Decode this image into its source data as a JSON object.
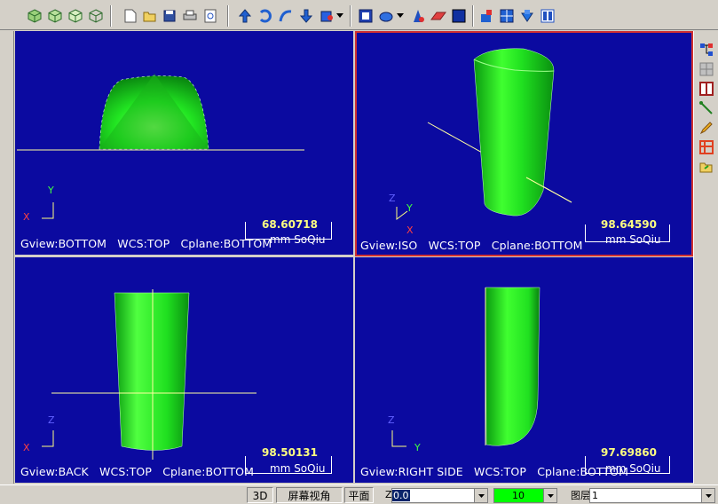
{
  "toolbar": {
    "icons": [
      "cube-iso-icon",
      "cube-top-icon",
      "cube-front-icon",
      "cube-wire-icon",
      "new-file-icon",
      "open-folder-icon",
      "save-icon",
      "print-icon",
      "print-preview-icon",
      "arrow-up-icon",
      "rotate-icon",
      "arc-icon",
      "arrow-down-icon",
      "solid-cube-icon",
      "dropdown-arrow-icon",
      "view-box-icon",
      "shade-icon",
      "dropdown-arrow-icon",
      "edge-icon",
      "eraser-icon",
      "solid-block-icon",
      "layers-icon",
      "grid-icon",
      "import-icon",
      "panel-icon"
    ]
  },
  "viewports": [
    {
      "label": "Gview:BOTTOM   WCS:TOP   Cplane:BOTTOM",
      "scale": "68.60718",
      "unit": "mm  SoQiu",
      "axis1": "X",
      "axis2": "Y"
    },
    {
      "label": "Gview:ISO   WCS:TOP   Cplane:BOTTOM",
      "scale": "98.64590",
      "unit": "mm  SoQiu",
      "axis1": "Z",
      "axis2": "Y",
      "axis3": "X"
    },
    {
      "label": "Gview:BACK   WCS:TOP   Cplane:BOTTOM",
      "scale": "98.50131",
      "unit": "mm  SoQiu",
      "axis1": "X",
      "axis2": "Z"
    },
    {
      "label": "Gview:RIGHT SIDE   WCS:TOP   Cplane:BOTTOM",
      "scale": "97.69860",
      "unit": "mm  SoQiu",
      "axis1": "Z",
      "axis2": "Y"
    }
  ],
  "status": {
    "mode_3d": "3D",
    "screen_view": "屏幕视角",
    "plane": "平面",
    "z_label": "Z",
    "z_value": "0.0",
    "color_value": "10",
    "layer_label": "图层",
    "layer_value": "1"
  },
  "colors": {
    "viewport_bg": "#0b0aa0",
    "model_green": "#22e622",
    "selected_border": "#d03030"
  }
}
